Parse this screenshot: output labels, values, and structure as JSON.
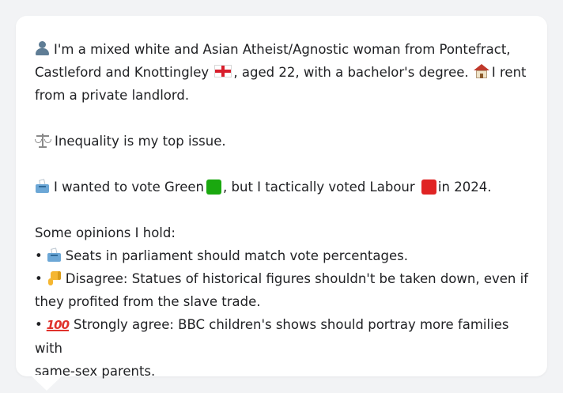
{
  "intro": {
    "text1": "I'm a mixed white and Asian Atheist/Agnostic woman from Pontefract,",
    "text2": "Castleford and Knottingley",
    "text3": ", aged 22, with a bachelor's degree.",
    "text4": "I rent",
    "text5": "from a private landlord."
  },
  "issue": {
    "text": "Inequality is my top issue."
  },
  "vote": {
    "text1": "I wanted to vote Green",
    "text2": ", but I tactically voted Labour",
    "text3": "in 2024.",
    "green_color": "#1aa80f",
    "labour_color": "#e02424"
  },
  "opinions": {
    "heading": "Some opinions I hold:",
    "bullet": "•",
    "item1": "Seats in parliament should match vote percentages.",
    "item2_line1": "Disagree: Statues of historical figures shouldn't be taken down, even if",
    "item2_line2": "they profited from the slave trade.",
    "item3_hundred": "100",
    "item3_line1": "Strongly agree: BBC children's shows should portray more families with",
    "item3_line2": "same-sex parents."
  }
}
